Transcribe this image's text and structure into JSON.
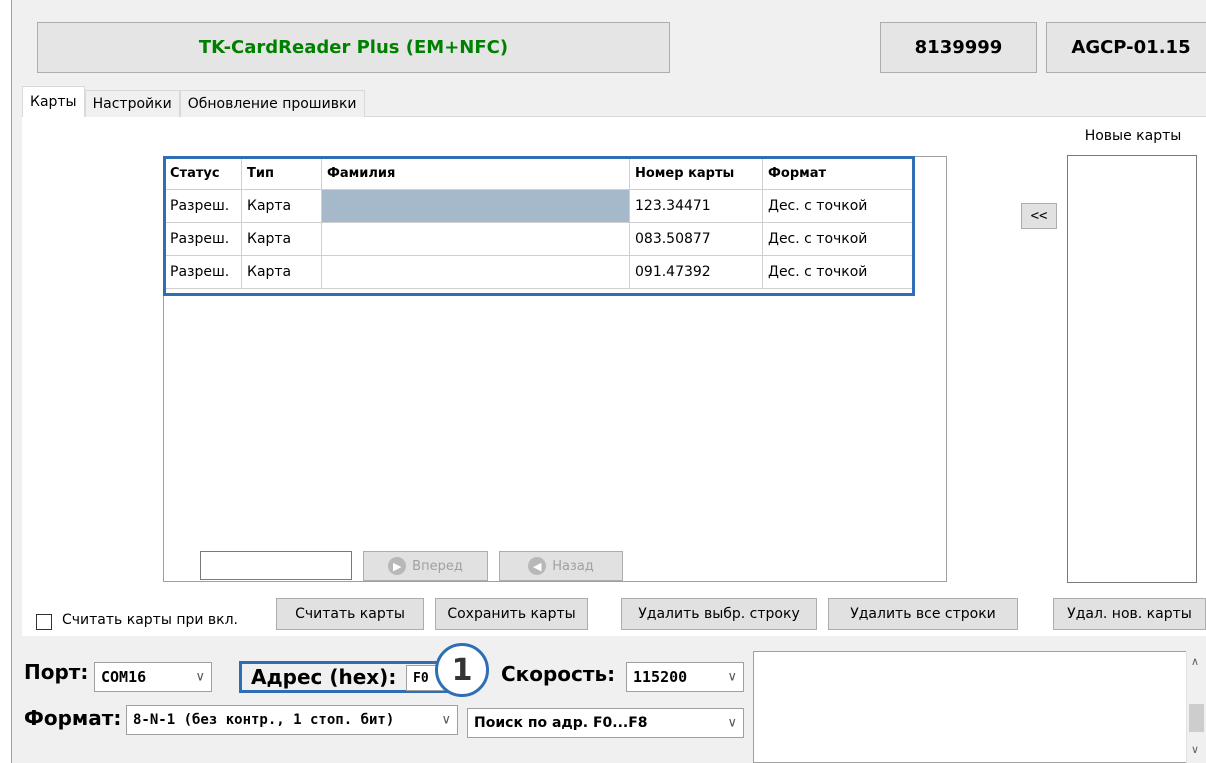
{
  "header": {
    "device_name": "TK-CardReader Plus (EM+NFC)",
    "serial": "8139999",
    "firmware": "AGCP-01.15",
    "accent_color": "#008000"
  },
  "tabs": [
    {
      "label": "Карты",
      "active": true
    },
    {
      "label": "Настройки",
      "active": false
    },
    {
      "label": "Обновление прошивки",
      "active": false
    }
  ],
  "cards_table": {
    "columns": [
      "Статус",
      "Тип",
      "Фамилия",
      "Номер карты",
      "Формат"
    ],
    "rows": [
      [
        "Разреш.",
        "Карта",
        "",
        "123.34471",
        "Дес. с точкой"
      ],
      [
        "Разреш.",
        "Карта",
        "",
        "083.50877",
        "Дес. с точкой"
      ],
      [
        "Разреш.",
        "Карта",
        "",
        "091.47392",
        "Дес. с точкой"
      ]
    ],
    "highlight_color": "#2f6db5",
    "selected_cell_color": "#a5b9cb"
  },
  "pagination": {
    "page_input_value": "",
    "forward_label": "Вперед",
    "back_label": "Назад"
  },
  "new_cards": {
    "title": "Новые карты",
    "transfer_label": "<<"
  },
  "actions": {
    "read_on_start_label": "Считать карты при вкл.",
    "read_on_start_checked": false,
    "read_label": "Считать карты",
    "save_label": "Сохранить карты",
    "delete_selected_label": "Удалить выбр. строку",
    "delete_all_label": "Удалить все строки",
    "delete_new_label": "Удал. нов. карты"
  },
  "connection": {
    "port_label": "Порт:",
    "port_value": "COM16",
    "address_label": "Адрес (hex):",
    "address_value": "F0",
    "speed_label": "Скорость:",
    "speed_value": "115200",
    "format_label": "Формат:",
    "format_value": "8-N-1 (без контр., 1 стоп. бит)",
    "search_value": "Поиск по адр. F0...F8",
    "marker": "1"
  }
}
